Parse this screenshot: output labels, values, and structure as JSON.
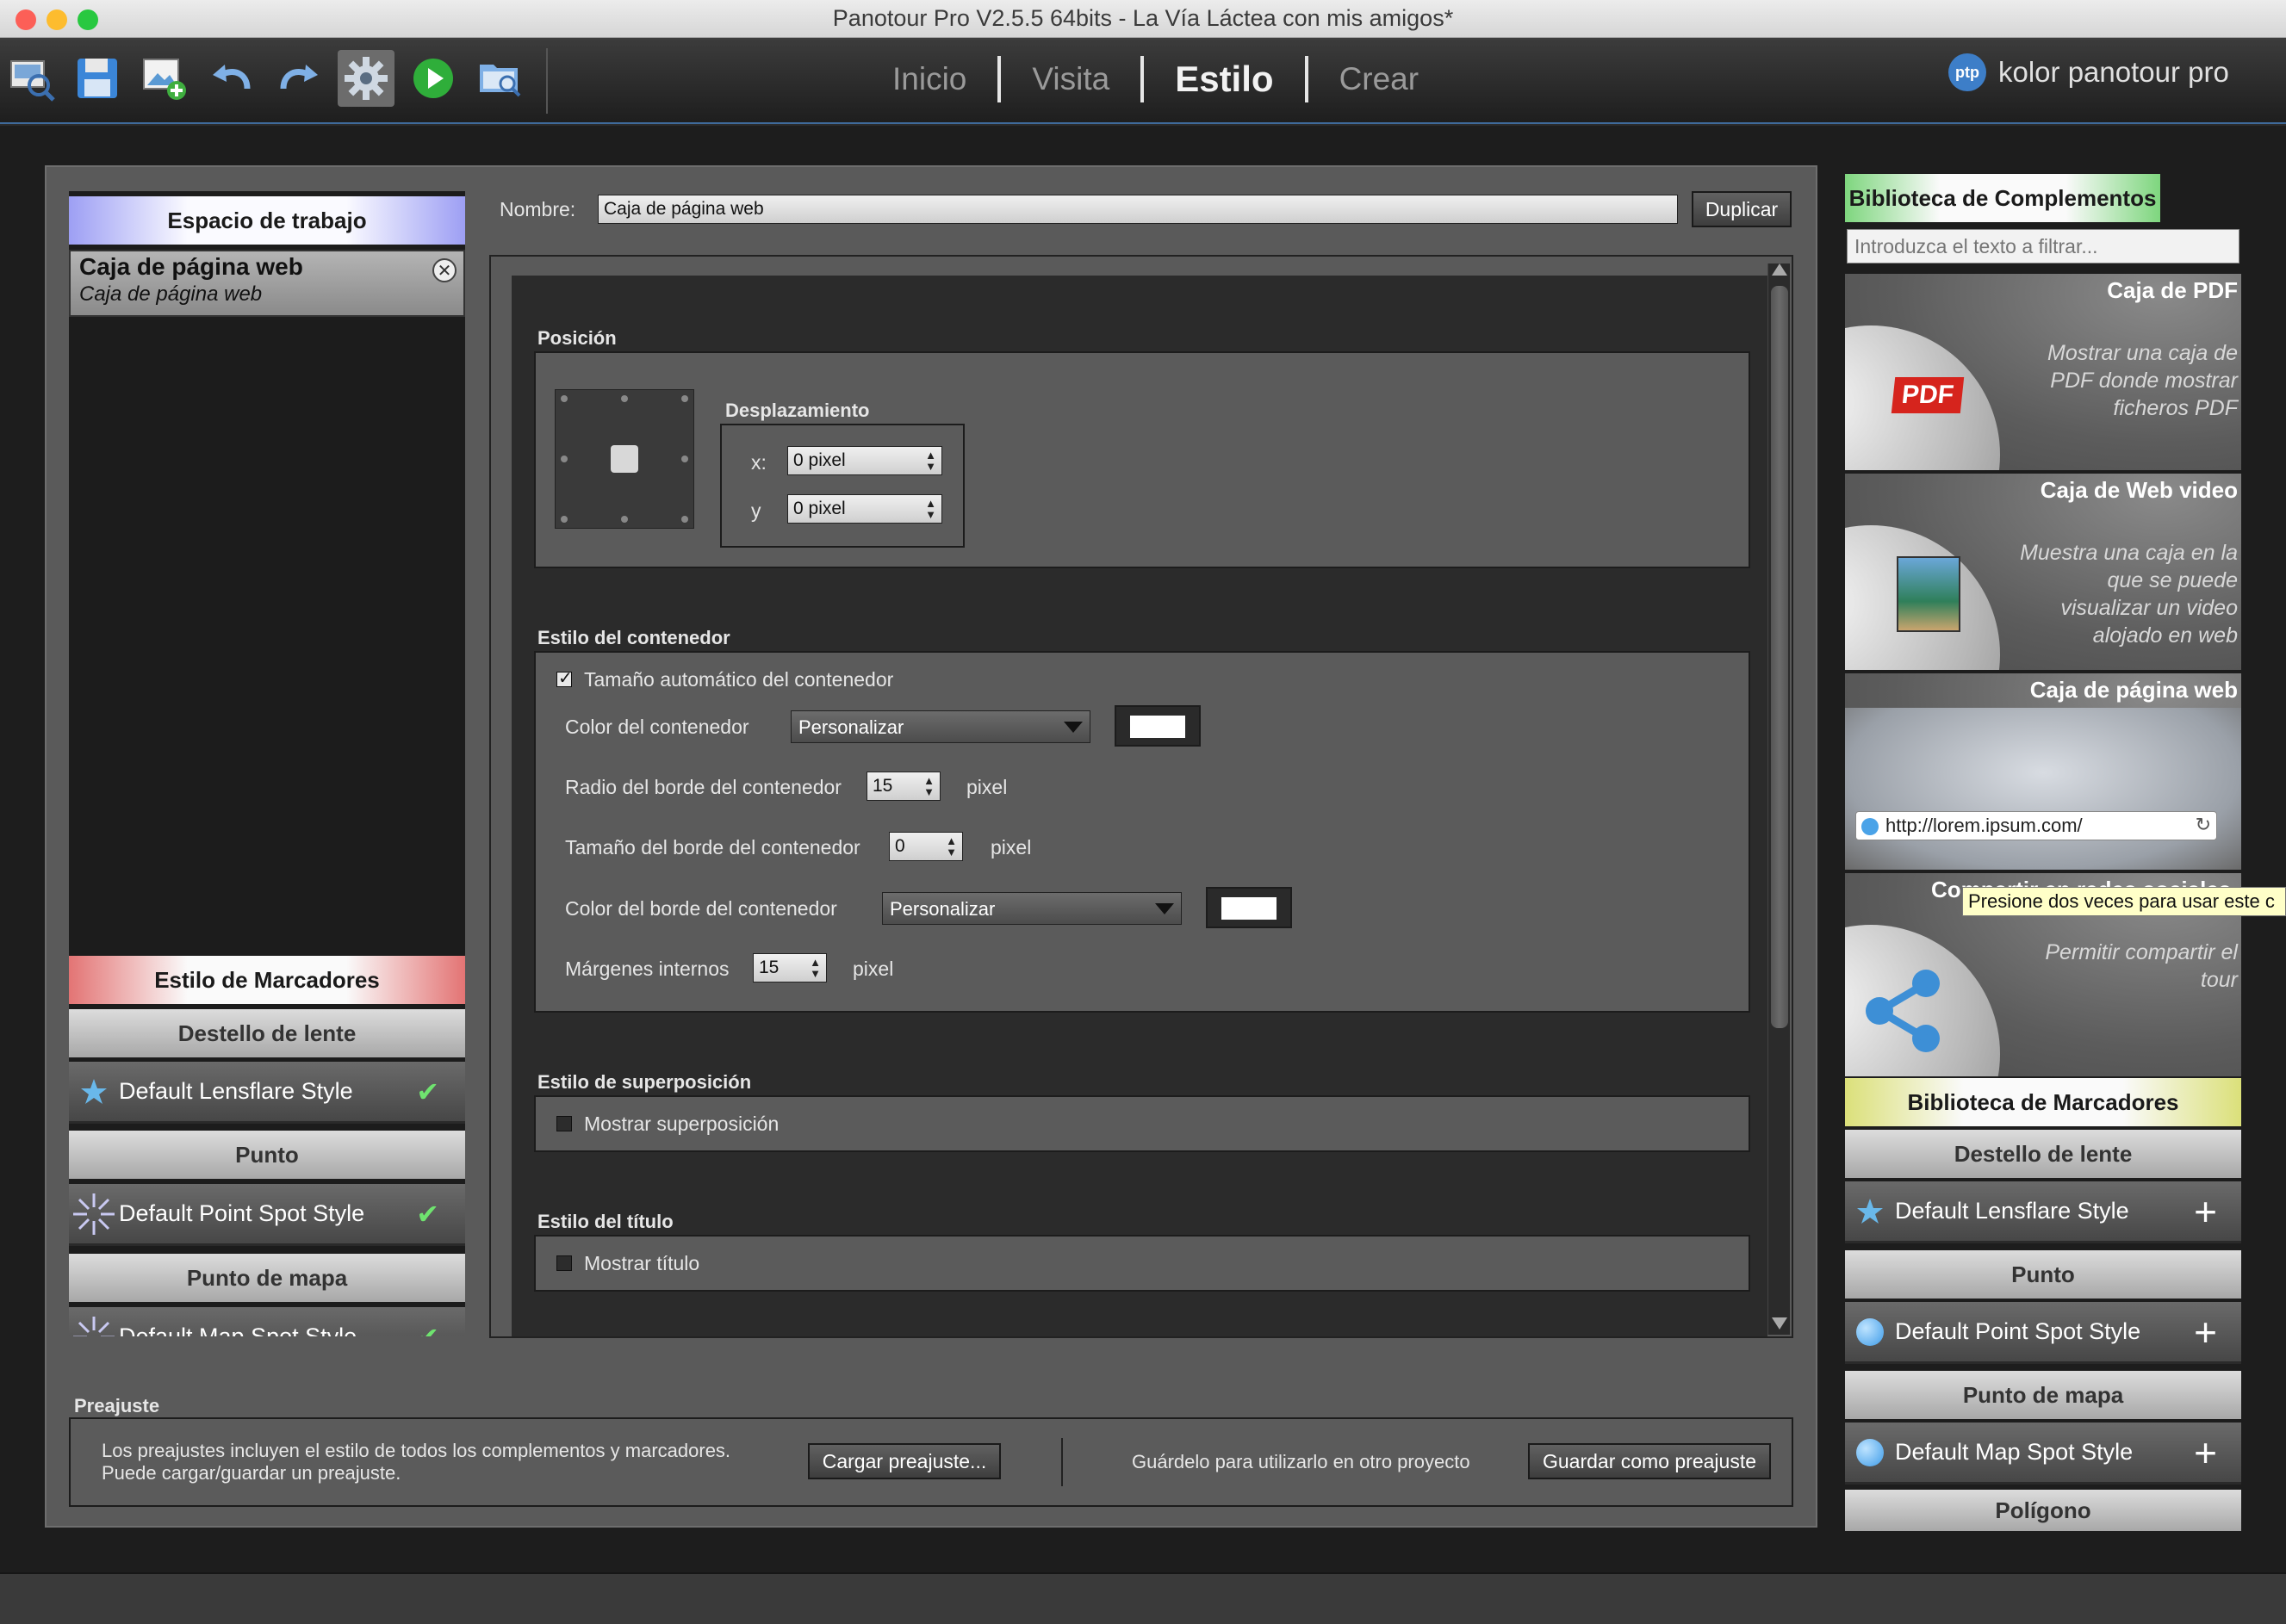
{
  "window": {
    "title": "Panotour Pro V2.5.5 64bits - La Vía Láctea con mis amigos*"
  },
  "toolbar": {
    "icons": [
      "tour-viewer-icon",
      "save-icon",
      "add-panorama-icon",
      "undo-icon",
      "redo-icon",
      "settings-icon",
      "play-icon",
      "folder-search-icon"
    ],
    "nav": [
      "Inicio",
      "Visita",
      "Estilo",
      "Crear"
    ],
    "active_nav": "Estilo",
    "brand_logo": "ptp",
    "brand": "kolor panotour pro"
  },
  "workspace": {
    "header": "Espacio de trabajo",
    "item_title": "Caja de página web",
    "item_subtitle": "Caja de página web"
  },
  "marker_styles": {
    "header": "Estilo de Marcadores",
    "groups": [
      {
        "category": "Destello de lente",
        "item": "Default Lensflare Style"
      },
      {
        "category": "Punto",
        "item": "Default Point Spot Style"
      },
      {
        "category": "Punto de mapa",
        "item": "Default Map Spot Style"
      }
    ]
  },
  "editor": {
    "name_label": "Nombre:",
    "name_value": "Caja de página web",
    "duplicate": "Duplicar",
    "position": {
      "title": "Posición",
      "offset_title": "Desplazamiento",
      "x_label": "x:",
      "x_value": "0 pixel",
      "y_label": "y",
      "y_value": "0 pixel"
    },
    "container": {
      "title": "Estilo del contenedor",
      "auto_size": "Tamaño automático del contenedor",
      "color_label": "Color del contenedor",
      "color_value": "Personalizar",
      "radius_label": "Radio del borde del contenedor",
      "radius_value": "15",
      "border_size_label": "Tamaño del borde del contenedor",
      "border_size_value": "0",
      "border_color_label": "Color del borde del contenedor",
      "border_color_value": "Personalizar",
      "padding_label": "Márgenes internos",
      "padding_value": "15",
      "unit": "pixel"
    },
    "overlay": {
      "title": "Estilo de superposición",
      "label": "Mostrar superposición"
    },
    "titlebox": {
      "title": "Estilo del título",
      "label": "Mostrar título"
    }
  },
  "preset": {
    "title": "Preajuste",
    "desc1": "Los preajustes incluyen el estilo de todos los complementos y marcadores.",
    "desc2": "Puede cargar/guardar un preajuste.",
    "load": "Cargar preajuste...",
    "save_hint": "Guárdelo para utilizarlo en otro proyecto",
    "save": "Guardar como preajuste"
  },
  "plugins": {
    "header": "Biblioteca de Complementos",
    "filter_placeholder": "Introduzca el texto a filtrar...",
    "items": [
      {
        "title": "Caja de PDF",
        "desc": "Mostrar una caja de PDF donde mostrar ficheros PDF",
        "badge": "PDF"
      },
      {
        "title": "Caja de Web video",
        "desc": "Muestra una caja en la que se puede visualizar un video alojado en web"
      },
      {
        "title": "Caja de página web",
        "url": "http://lorem.ipsum.com/"
      },
      {
        "title": "Compartir en redes sociales",
        "desc": "Permitir compartir el tour"
      }
    ],
    "tooltip": "Presione dos veces para usar este c"
  },
  "marker_library": {
    "header": "Biblioteca de Marcadores",
    "groups": [
      {
        "category": "Destello de lente",
        "item": "Default Lensflare Style"
      },
      {
        "category": "Punto",
        "item": "Default Point Spot Style"
      },
      {
        "category": "Punto de mapa",
        "item": "Default Map Spot Style"
      },
      {
        "category": "Polígono"
      }
    ]
  },
  "colors": {
    "accent_blue": "#3f6a9a",
    "check_green": "#6fe36f",
    "container_color": "#ffffff"
  }
}
